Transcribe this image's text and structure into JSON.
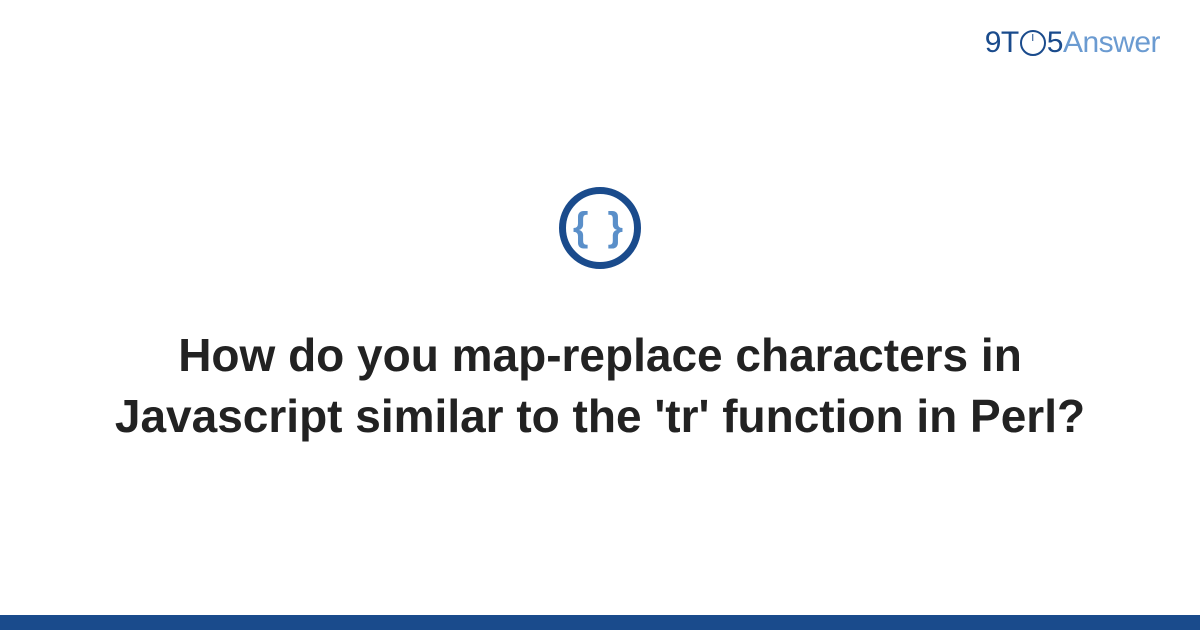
{
  "logo": {
    "part1": "9T",
    "clock_inner": "{ }",
    "part2": "5",
    "part3": "Answer"
  },
  "icon": {
    "glyph": "{ }",
    "name": "code-braces-icon"
  },
  "question": {
    "title": "How do you map-replace characters in Javascript similar to the 'tr' function in Perl?"
  },
  "colors": {
    "primary": "#1a4b8c",
    "secondary": "#6b9bd1",
    "text": "#222222"
  }
}
